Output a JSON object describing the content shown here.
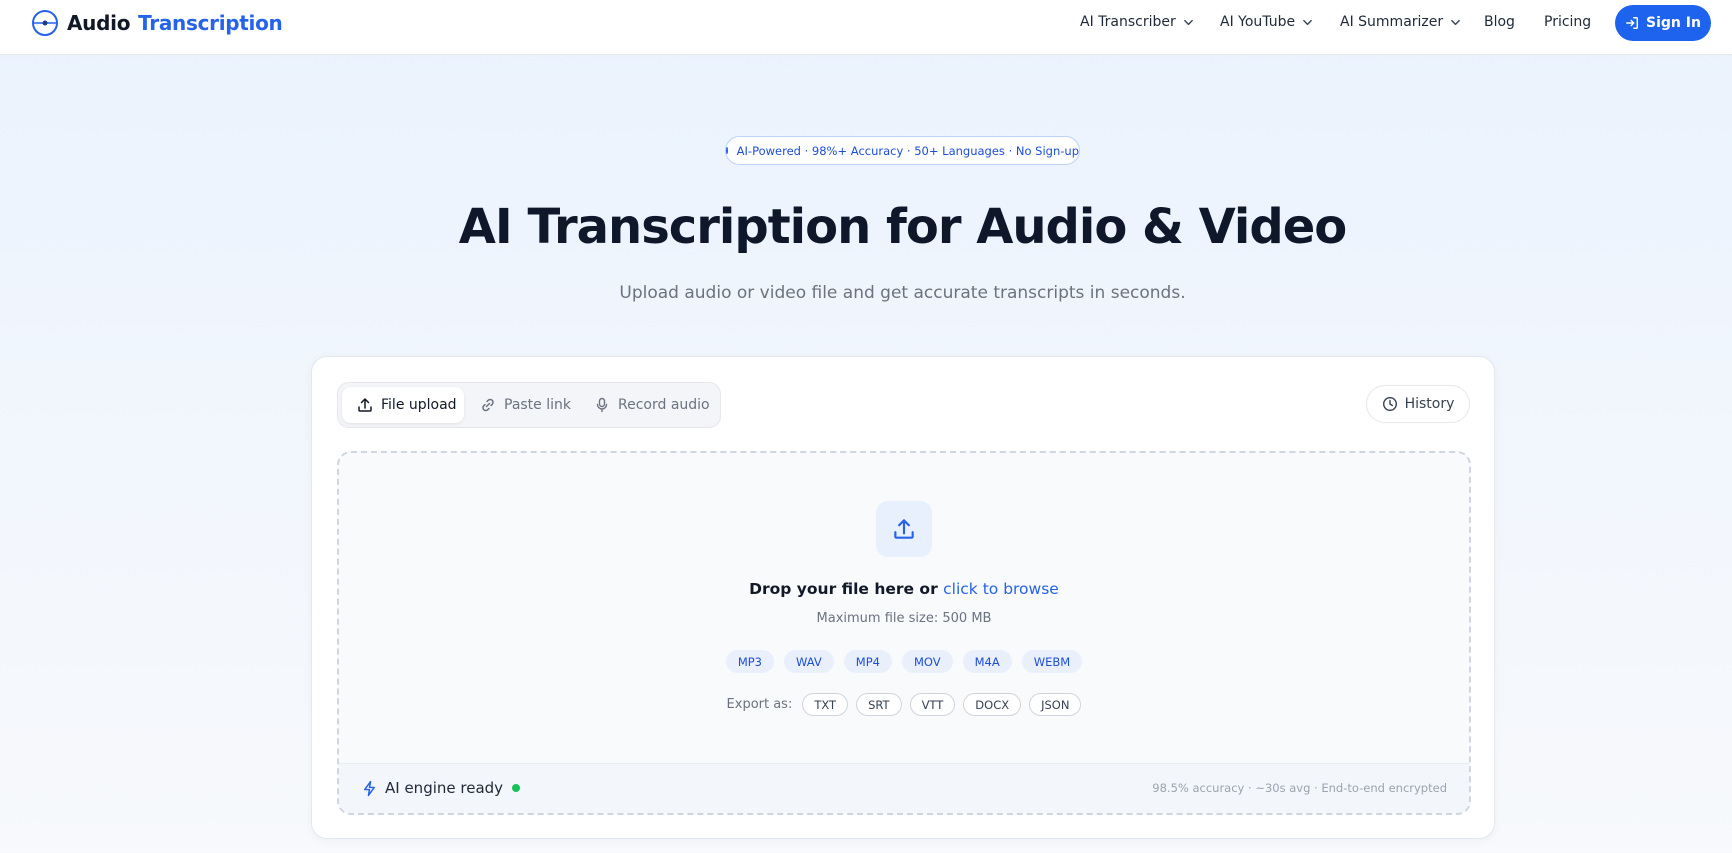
{
  "header": {
    "logo_part1": "Audio",
    "logo_part2": "Transcription",
    "nav": [
      {
        "label": "AI Transcriber"
      },
      {
        "label": "AI YouTube"
      },
      {
        "label": "AI Summarizer"
      },
      {
        "label": "Blog"
      },
      {
        "label": "Pricing"
      }
    ],
    "signin_label": "Sign In"
  },
  "hero": {
    "badge": "AI-Powered · 98%+ Accuracy · 50+ Languages · No Sign-up",
    "title": "AI Transcription for Audio & Video",
    "subtitle": "Upload audio or video file and get accurate transcripts in seconds."
  },
  "card": {
    "tabs": [
      {
        "label": "File upload",
        "icon": "upload-icon",
        "active": true
      },
      {
        "label": "Paste link",
        "icon": "link-icon",
        "active": false
      },
      {
        "label": "Record audio",
        "icon": "microphone-icon",
        "active": false
      }
    ],
    "history_label": "History",
    "dropzone": {
      "title_prefix": "Drop your file here or",
      "browse_link": "click to browse",
      "max_size": "Maximum file size: 500 MB",
      "formats": [
        "MP3",
        "WAV",
        "MP4",
        "MOV",
        "M4A",
        "WEBM"
      ],
      "export_label": "Export as:",
      "exports": [
        "TXT",
        "SRT",
        "VTT",
        "DOCX",
        "JSON"
      ]
    },
    "status": {
      "engine_label": "AI engine ready",
      "stats": "98.5% accuracy · ~30s avg · End-to-end encrypted"
    }
  },
  "colors": {
    "accent": "#2563eb",
    "button": "#1d63ed",
    "ready_dot": "#16c25c"
  }
}
